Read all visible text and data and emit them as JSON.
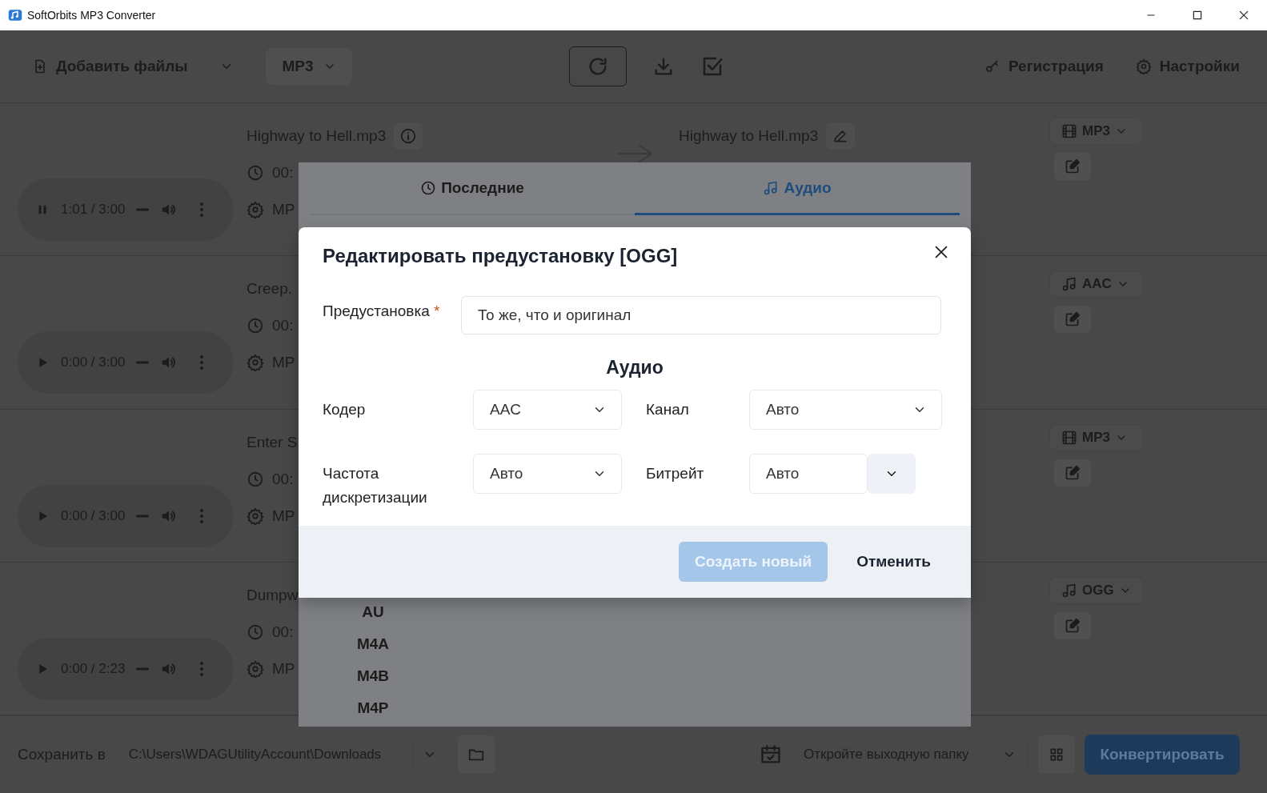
{
  "window": {
    "title": "SoftOrbits MP3 Converter"
  },
  "toolbar": {
    "add_files": "Добавить файлы",
    "format": "MP3",
    "register": "Регистрация",
    "settings": "Настройки"
  },
  "files": [
    {
      "name": "Highway to Hell.mp3",
      "duration": "00:",
      "preset": "MP",
      "player": {
        "playing": true,
        "time": "1:01 / 3:00"
      },
      "output_name": "Highway to Hell.mp3",
      "target": {
        "kind": "video",
        "label": "MP3"
      }
    },
    {
      "name": "Creep.",
      "duration": "00:",
      "preset": "MP",
      "player": {
        "playing": false,
        "time": "0:00 / 3:00"
      },
      "target": {
        "kind": "audio",
        "label": "AAC"
      }
    },
    {
      "name": "Enter S",
      "duration": "00:",
      "preset": "MP",
      "player": {
        "playing": false,
        "time": "0:00 / 3:00"
      },
      "target": {
        "kind": "video",
        "label": "MP3"
      }
    },
    {
      "name": "Dumpw",
      "duration": "00:",
      "preset": "MP",
      "player": {
        "playing": false,
        "time": "0:00 / 2:23"
      },
      "target": {
        "kind": "audio",
        "label": "OGG"
      }
    }
  ],
  "preset_popover": {
    "tabs": [
      {
        "label": "Последние",
        "kind": "recent",
        "selected": false
      },
      {
        "label": "Аудио",
        "kind": "audio",
        "selected": true
      }
    ],
    "formats": [
      "AU",
      "M4A",
      "M4B",
      "M4P"
    ]
  },
  "dialog": {
    "title": "Редактировать предустановку [OGG]",
    "preset_label": "Предустановка",
    "required_mark": "*",
    "preset_value": "То же, что и оригинал",
    "section": "Аудио",
    "fields": [
      {
        "label": "Кодер",
        "value": "AAC",
        "kind": "select"
      },
      {
        "label": "Канал",
        "value": "Авто",
        "kind": "select"
      },
      {
        "label": "Частота дискретизации",
        "value": "Авто",
        "kind": "select"
      },
      {
        "label": "Битрейт",
        "value": "Авто",
        "kind": "combo"
      }
    ],
    "create_button": {
      "label": "Создать новый",
      "disabled": true
    },
    "cancel_button": "Отменить"
  },
  "bottom_bar": {
    "save_label": "Сохранить в",
    "path": "C:\\Users\\WDAGUtilityAccount\\Downloads",
    "after_action": "Откройте выходную папку",
    "convert": "Конвертировать"
  }
}
